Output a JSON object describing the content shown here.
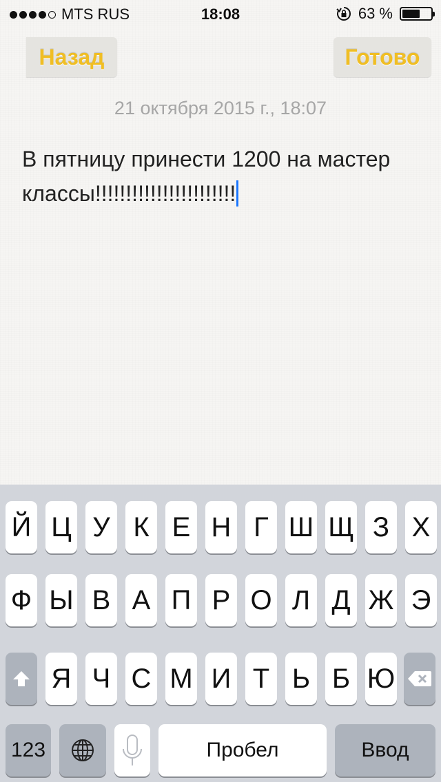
{
  "status_bar": {
    "carrier": "MTS RUS",
    "time": "18:08",
    "battery_percent": "63 %",
    "battery_level": 0.63,
    "signal_bars": 4,
    "signal_total": 5
  },
  "nav": {
    "back_label": "Назад",
    "done_label": "Готово",
    "accent_color": "#f0be24"
  },
  "note": {
    "date": "21 октября 2015 г., 18:07",
    "text": "В пятницу принести 1200 на мастер классы!!!!!!!!!!!!!!!!!!!!!!!"
  },
  "keyboard": {
    "row1": [
      "Й",
      "Ц",
      "У",
      "К",
      "Е",
      "Н",
      "Г",
      "Ш",
      "Щ",
      "З",
      "Х"
    ],
    "row2": [
      "Ф",
      "Ы",
      "В",
      "А",
      "П",
      "Р",
      "О",
      "Л",
      "Д",
      "Ж",
      "Э"
    ],
    "row3": [
      "Я",
      "Ч",
      "С",
      "М",
      "И",
      "Т",
      "Ь",
      "Б",
      "Ю"
    ],
    "numbers_label": "123",
    "space_label": "Пробел",
    "return_label": "Ввод",
    "icons": {
      "shift": "shift-arrow-icon",
      "delete": "backspace-icon",
      "globe": "globe-icon",
      "mic": "microphone-icon"
    }
  }
}
